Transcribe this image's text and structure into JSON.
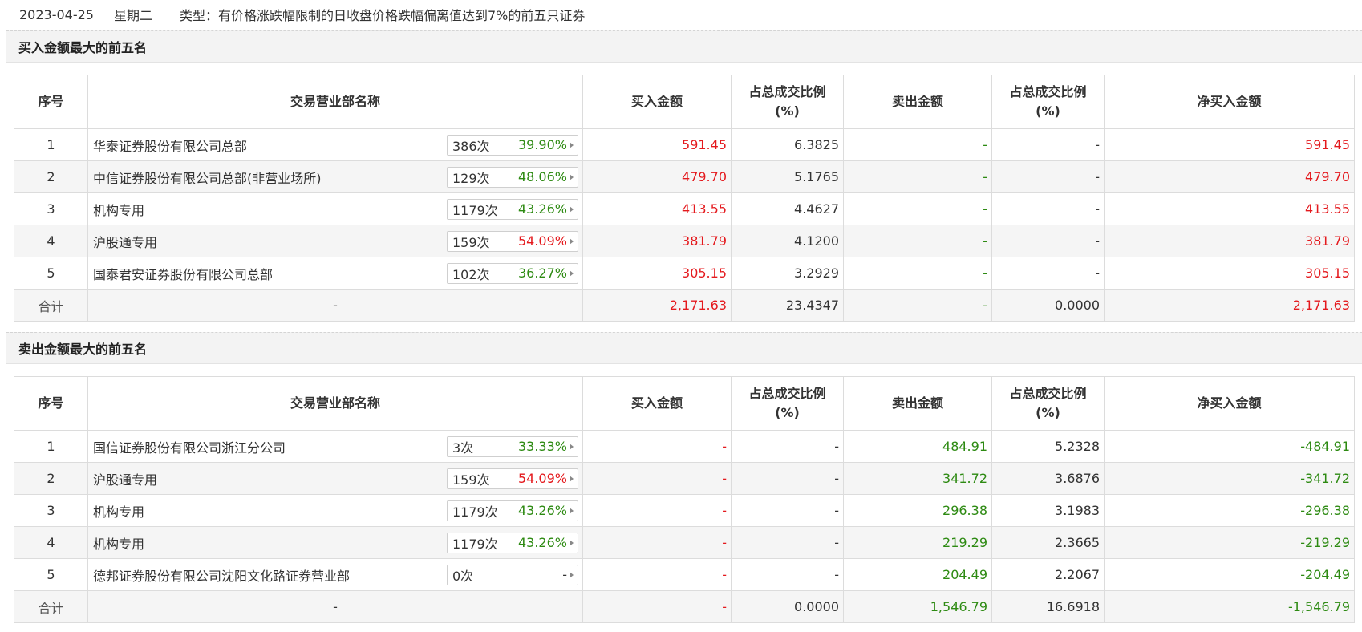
{
  "header": {
    "date": "2023-04-25",
    "weekday": "星期二",
    "type_text": "类型：有价格涨跌幅限制的日收盘价格跌幅偏离值达到7%的前五只证券"
  },
  "colors": {
    "up": "#e4191d",
    "down": "#2d8a12"
  },
  "columns": {
    "seq": "序号",
    "name": "交易营业部名称",
    "buy": "买入金额",
    "buy_ratio_l1": "占总成交比例",
    "buy_ratio_l2": "(%)",
    "sell": "卖出金额",
    "sell_ratio_l1": "占总成交比例",
    "sell_ratio_l2": "(%)",
    "net": "净买入金额"
  },
  "buy_section": {
    "title": "买入金额最大的前五名",
    "rows": [
      {
        "seq": "1",
        "name": "华泰证券股份有限公司总部",
        "count": "386次",
        "pct": "39.90%",
        "pct_color": "green",
        "buy": "591.45",
        "buy_ratio": "6.3825",
        "sell": "-",
        "sell_ratio": "-",
        "net": "591.45"
      },
      {
        "seq": "2",
        "name": "中信证券股份有限公司总部(非营业场所)",
        "count": "129次",
        "pct": "48.06%",
        "pct_color": "green",
        "buy": "479.70",
        "buy_ratio": "5.1765",
        "sell": "-",
        "sell_ratio": "-",
        "net": "479.70"
      },
      {
        "seq": "3",
        "name": "机构专用",
        "count": "1179次",
        "pct": "43.26%",
        "pct_color": "green",
        "buy": "413.55",
        "buy_ratio": "4.4627",
        "sell": "-",
        "sell_ratio": "-",
        "net": "413.55"
      },
      {
        "seq": "4",
        "name": "沪股通专用",
        "count": "159次",
        "pct": "54.09%",
        "pct_color": "red",
        "buy": "381.79",
        "buy_ratio": "4.1200",
        "sell": "-",
        "sell_ratio": "-",
        "net": "381.79"
      },
      {
        "seq": "5",
        "name": "国泰君安证券股份有限公司总部",
        "count": "102次",
        "pct": "36.27%",
        "pct_color": "green",
        "buy": "305.15",
        "buy_ratio": "3.2929",
        "sell": "-",
        "sell_ratio": "-",
        "net": "305.15"
      }
    ],
    "total": {
      "label": "合计",
      "name": "-",
      "buy": "2,171.63",
      "buy_ratio": "23.4347",
      "sell": "-",
      "sell_ratio": "0.0000",
      "net": "2,171.63"
    }
  },
  "sell_section": {
    "title": "卖出金额最大的前五名",
    "rows": [
      {
        "seq": "1",
        "name": "国信证券股份有限公司浙江分公司",
        "count": "3次",
        "pct": "33.33%",
        "pct_color": "green",
        "buy": "-",
        "buy_ratio": "-",
        "sell": "484.91",
        "sell_ratio": "5.2328",
        "net": "-484.91"
      },
      {
        "seq": "2",
        "name": "沪股通专用",
        "count": "159次",
        "pct": "54.09%",
        "pct_color": "red",
        "buy": "-",
        "buy_ratio": "-",
        "sell": "341.72",
        "sell_ratio": "3.6876",
        "net": "-341.72"
      },
      {
        "seq": "3",
        "name": "机构专用",
        "count": "1179次",
        "pct": "43.26%",
        "pct_color": "green",
        "buy": "-",
        "buy_ratio": "-",
        "sell": "296.38",
        "sell_ratio": "3.1983",
        "net": "-296.38"
      },
      {
        "seq": "4",
        "name": "机构专用",
        "count": "1179次",
        "pct": "43.26%",
        "pct_color": "green",
        "buy": "-",
        "buy_ratio": "-",
        "sell": "219.29",
        "sell_ratio": "2.3665",
        "net": "-219.29"
      },
      {
        "seq": "5",
        "name": "德邦证券股份有限公司沈阳文化路证券营业部",
        "count": "0次",
        "pct": "-",
        "pct_color": "dark",
        "buy": "-",
        "buy_ratio": "-",
        "sell": "204.49",
        "sell_ratio": "2.2067",
        "net": "-204.49"
      }
    ],
    "total": {
      "label": "合计",
      "name": "-",
      "buy": "-",
      "buy_ratio": "0.0000",
      "sell": "1,546.79",
      "sell_ratio": "16.6918",
      "net": "-1,546.79"
    }
  }
}
